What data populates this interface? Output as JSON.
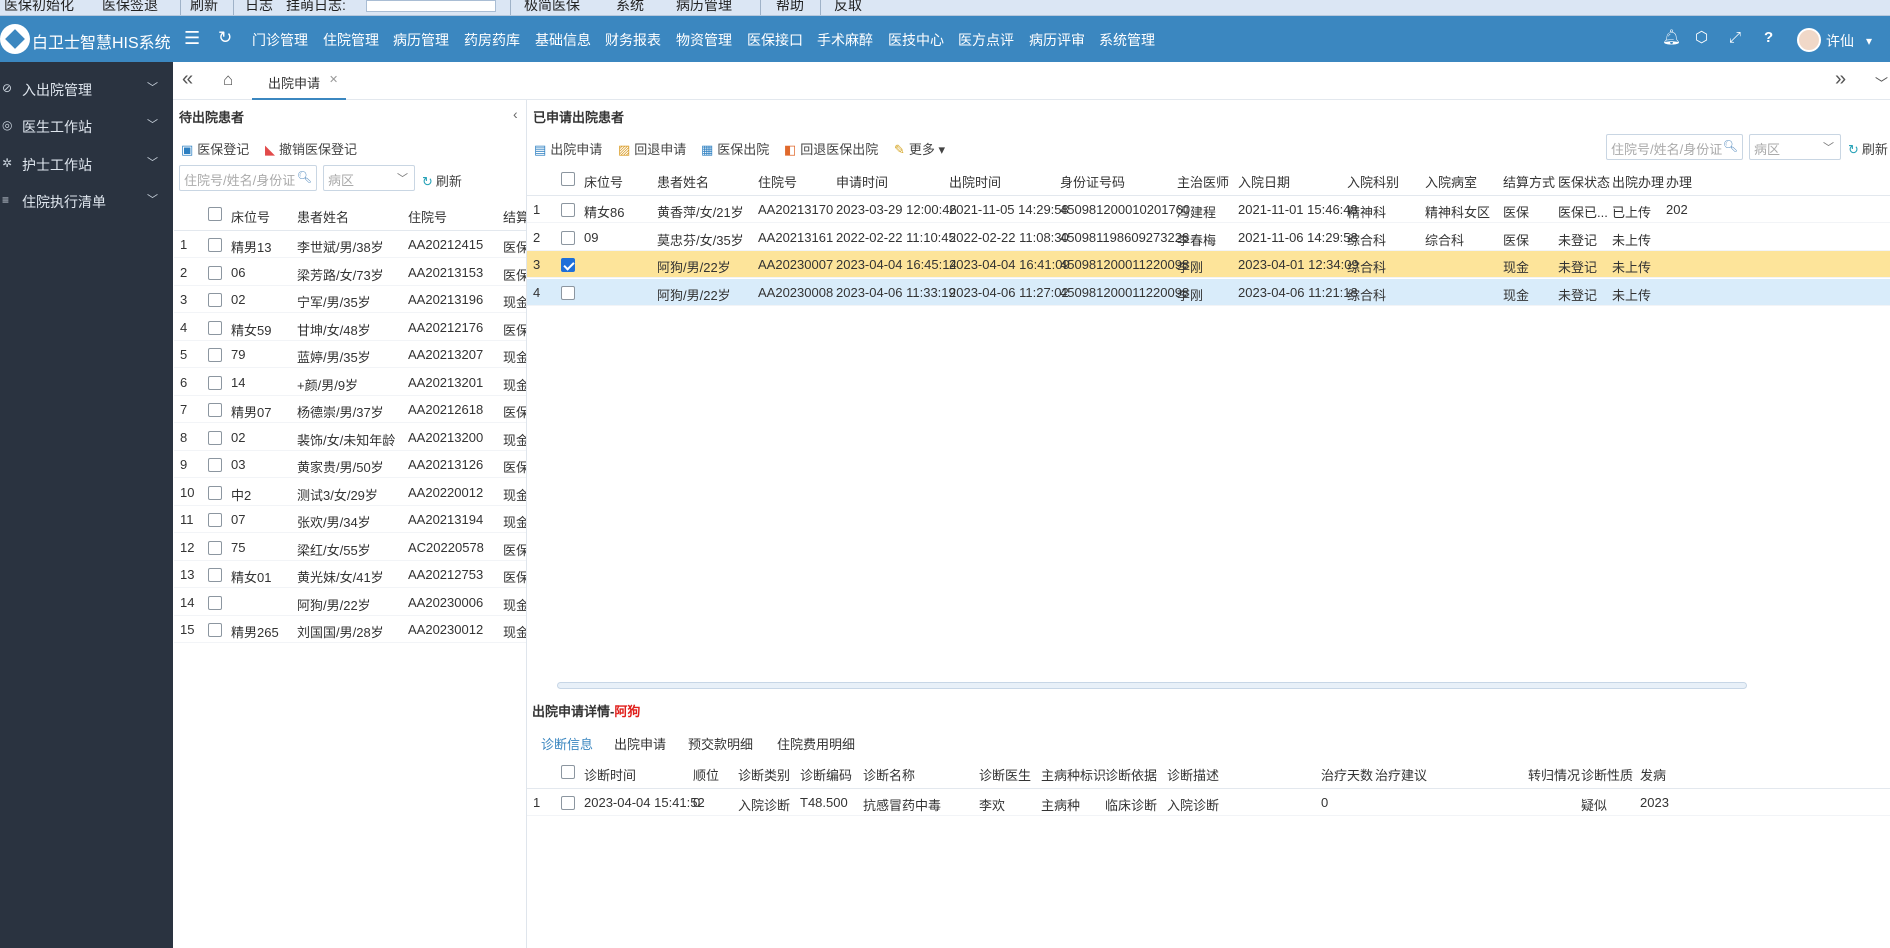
{
  "os_bar": {
    "items": [
      "医保初始化",
      "医保签退",
      "刷新",
      "日志",
      "挂萌日志:",
      "极简医保",
      "系统",
      "病历管理",
      "帮助",
      "反取"
    ]
  },
  "header": {
    "brand": "白卫士智慧HIS系统",
    "menu": [
      "门诊管理",
      "住院管理",
      "病历管理",
      "药房药库",
      "基础信息",
      "财务报表",
      "物资管理",
      "医保接口",
      "手术麻醉",
      "医技中心",
      "医方点评",
      "病历评审",
      "系统管理"
    ],
    "active_menu": "住院管理",
    "user_name": "许仙"
  },
  "sidebar": {
    "items": [
      "入出院管理",
      "医生工作站",
      "护士工作站",
      "住院执行清单"
    ]
  },
  "tabs": {
    "active_label": "出院申请"
  },
  "left_panel": {
    "title": "待出院患者",
    "toolbar": {
      "insurance_register": "医保登记",
      "cancel_register": "撤销医保登记"
    },
    "search_placeholder": "住院号/姓名/身份证",
    "ward_placeholder": "病区",
    "refresh_label": "刷新",
    "columns": [
      "床位号",
      "患者姓名",
      "住院号",
      "结算"
    ],
    "rows": [
      {
        "no": "1",
        "bed": "精男13",
        "name": "李世斌/男/38岁",
        "admission": "AA20212415",
        "settle": "医保"
      },
      {
        "no": "2",
        "bed": "06",
        "name": "梁芳路/女/73岁",
        "admission": "AA20213153",
        "settle": "医保"
      },
      {
        "no": "3",
        "bed": "02",
        "name": "宁军/男/35岁",
        "admission": "AA20213196",
        "settle": "现金"
      },
      {
        "no": "4",
        "bed": "精女59",
        "name": "甘坤/女/48岁",
        "admission": "AA20212176",
        "settle": "医保"
      },
      {
        "no": "5",
        "bed": "79",
        "name": "蓝婷/男/35岁",
        "admission": "AA20213207",
        "settle": "现金"
      },
      {
        "no": "6",
        "bed": "14",
        "name": "+颜/男/9岁",
        "admission": "AA20213201",
        "settle": "现金"
      },
      {
        "no": "7",
        "bed": "精男07",
        "name": "杨德崇/男/37岁",
        "admission": "AA20212618",
        "settle": "医保"
      },
      {
        "no": "8",
        "bed": "02",
        "name": "裴饰/女/未知年龄",
        "admission": "AA20213200",
        "settle": "现金"
      },
      {
        "no": "9",
        "bed": "03",
        "name": "黄家贵/男/50岁",
        "admission": "AA20213126",
        "settle": "医保"
      },
      {
        "no": "10",
        "bed": "中2",
        "name": "测试3/女/29岁",
        "admission": "AA20220012",
        "settle": "现金"
      },
      {
        "no": "11",
        "bed": "07",
        "name": "张欢/男/34岁",
        "admission": "AA20213194",
        "settle": "现金"
      },
      {
        "no": "12",
        "bed": "75",
        "name": "梁红/女/55岁",
        "admission": "AC20220578",
        "settle": "医保"
      },
      {
        "no": "13",
        "bed": "精女01",
        "name": "黄光妹/女/41岁",
        "admission": "AA20212753",
        "settle": "医保"
      },
      {
        "no": "14",
        "bed": "",
        "name": "阿狗/男/22岁",
        "admission": "AA20230006",
        "settle": "现金"
      },
      {
        "no": "15",
        "bed": "精男265",
        "name": "刘国国/男/28岁",
        "admission": "AA20230012",
        "settle": "现金"
      }
    ]
  },
  "right_panel": {
    "title": "已申请出院患者",
    "toolbar": {
      "apply": "出院申请",
      "withdraw": "回退申请",
      "insurance_discharge": "医保出院",
      "withdraw_insurance": "回退医保出院",
      "more": "更多"
    },
    "search_placeholder": "住院号/姓名/身份证",
    "ward_placeholder": "病区",
    "refresh_label": "刷新",
    "columns": [
      "床位号",
      "患者姓名",
      "住院号",
      "申请时间",
      "出院时间",
      "身份证号码",
      "主治医师",
      "入院日期",
      "入院科别",
      "入院病室",
      "结算方式",
      "医保状态",
      "出院办理",
      "办理"
    ],
    "rows": [
      {
        "no": "1",
        "bed": "精女86",
        "name": "黄香萍/女/21岁",
        "admission": "AA20213170",
        "apply_time": "2023-03-29 12:00:46",
        "discharge_time": "2021-11-05 14:29:58",
        "id_no": "450981200010201760",
        "doctor": "冯建程",
        "admit_date": "2021-11-01 15:46:48",
        "dept": "精神科",
        "ward": "精神科女区",
        "settle": "医保",
        "ins_status": "医保已...",
        "handle": "已上传",
        "extra": "202"
      },
      {
        "no": "2",
        "bed": "09",
        "name": "莫忠芬/女/35岁",
        "admission": "AA20213161",
        "apply_time": "2022-02-22 11:10:45",
        "discharge_time": "2022-02-22 11:08:30",
        "id_no": "450981198609273226",
        "doctor": "李春梅",
        "admit_date": "2021-11-06 14:29:58",
        "dept": "综合科",
        "ward": "综合科",
        "settle": "医保",
        "ins_status": "未登记",
        "handle": "未上传",
        "extra": ""
      },
      {
        "no": "3",
        "bed": "",
        "name": "阿狗/男/22岁",
        "admission": "AA20230007",
        "apply_time": "2023-04-04 16:45:14",
        "discharge_time": "2023-04-04 16:41:09",
        "id_no": "450981200011220098",
        "doctor": "李刚",
        "admit_date": "2023-04-01 12:34:09",
        "dept": "综合科",
        "ward": "",
        "settle": "现金",
        "ins_status": "未登记",
        "handle": "未上传",
        "extra": ""
      },
      {
        "no": "4",
        "bed": "",
        "name": "阿狗/男/22岁",
        "admission": "AA20230008",
        "apply_time": "2023-04-06 11:33:19",
        "discharge_time": "2023-04-06 11:27:02",
        "id_no": "450981200011220098",
        "doctor": "李刚",
        "admit_date": "2023-04-06 11:21:18",
        "dept": "综合科",
        "ward": "",
        "settle": "现金",
        "ins_status": "未登记",
        "handle": "未上传",
        "extra": ""
      }
    ],
    "selected_row": 3
  },
  "detail": {
    "title_prefix": "出院申请详情-",
    "title_name": "阿狗",
    "tabs": [
      "诊断信息",
      "出院申请",
      "预交款明细",
      "住院费用明细"
    ],
    "active_tab": "诊断信息",
    "columns": [
      "诊断时间",
      "顺位",
      "诊断类别",
      "诊断编码",
      "诊断名称",
      "诊断医生",
      "主病种标识",
      "诊断依据",
      "诊断描述",
      "治疗天数",
      "治疗建议",
      "转归情况",
      "诊断性质",
      "发病"
    ],
    "rows": [
      {
        "no": "1",
        "time": "2023-04-04 15:41:52",
        "order": "0",
        "category": "入院诊断",
        "code": "T48.500",
        "diag_name": "抗感冒药中毒",
        "doctor": "李欢",
        "main_flag": "主病种",
        "basis": "临床诊断",
        "desc": "入院诊断",
        "days": "0",
        "advice": "",
        "outcome": "",
        "nature": "疑似",
        "onset": "2023"
      }
    ]
  }
}
